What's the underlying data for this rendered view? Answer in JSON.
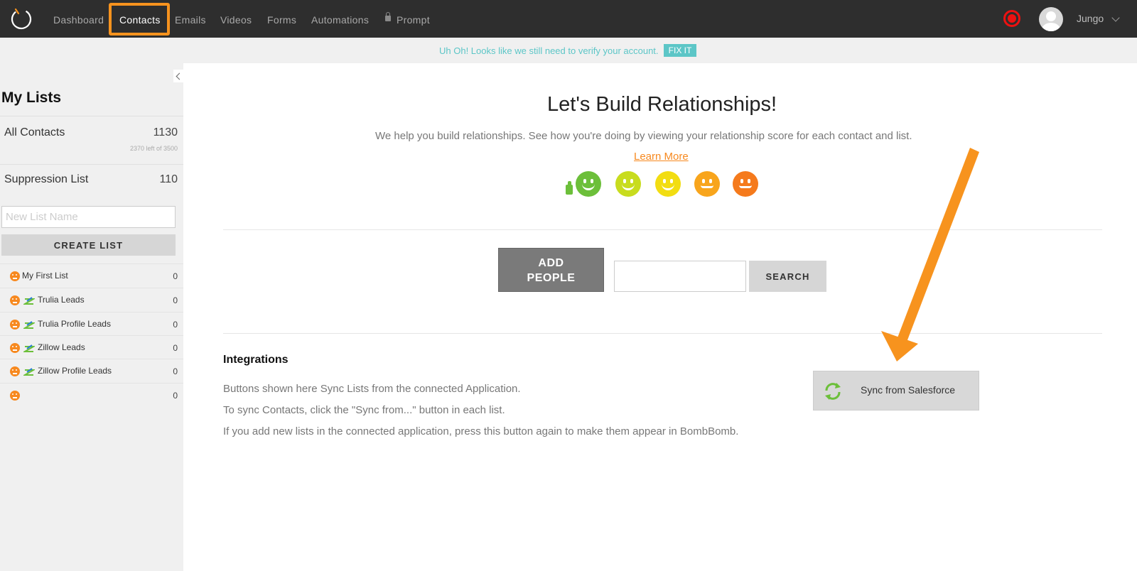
{
  "nav": {
    "items": [
      {
        "label": "Dashboard"
      },
      {
        "label": "Contacts"
      },
      {
        "label": "Emails"
      },
      {
        "label": "Videos"
      },
      {
        "label": "Forms"
      },
      {
        "label": "Automations"
      },
      {
        "label": "Prompt"
      }
    ],
    "active": "Contacts",
    "username": "Jungo",
    "highlight_color": "#f7931e"
  },
  "banner": {
    "text": "Uh Oh! Looks like we still need to verify your account.",
    "action": "FIX IT",
    "color": "#5cc6c7"
  },
  "sidebar": {
    "title": "My Lists",
    "all_contacts": {
      "label": "All Contacts",
      "count": "1130",
      "quota": "2370 left of 3500"
    },
    "suppression": {
      "label": "Suppression List",
      "count": "110"
    },
    "new_list_placeholder": "New List Name",
    "create_label": "CREATE LIST",
    "lists": [
      {
        "name": "My First List",
        "count": "0",
        "icon": "frown-face-icon",
        "integration": false
      },
      {
        "name": "Trulia Leads",
        "count": "0",
        "icon": "frown-face-icon",
        "integration": true
      },
      {
        "name": "Trulia Profile Leads",
        "count": "0",
        "icon": "frown-face-icon",
        "integration": true
      },
      {
        "name": "Zillow Leads",
        "count": "0",
        "icon": "frown-face-icon",
        "integration": true
      },
      {
        "name": "Zillow Profile Leads",
        "count": "0",
        "icon": "frown-face-icon",
        "integration": true
      },
      {
        "name": "",
        "count": "0",
        "icon": "frown-face-icon",
        "integration": false
      }
    ]
  },
  "main": {
    "headline": "Let's Build Relationships!",
    "subline": "We help you build relationships. See how you're doing by viewing your relationship score for each contact and list.",
    "learn_more": "Learn More",
    "score_colors": [
      "#6cbf3a",
      "#c8dc1e",
      "#f2dd12",
      "#f8a51c",
      "#f57a1c"
    ],
    "add_people": "ADD PEOPLE",
    "search_label": "SEARCH",
    "integrations": {
      "title": "Integrations",
      "lines": [
        "Buttons shown here Sync Lists from the connected Application.",
        "To sync Contacts, click the \"Sync from...\" button in each list.",
        "If you add new lists in the connected application, press this button again to make them appear in BombBomb."
      ],
      "sync_label": "Sync from Salesforce",
      "arrow_color": "#f7931e"
    }
  }
}
